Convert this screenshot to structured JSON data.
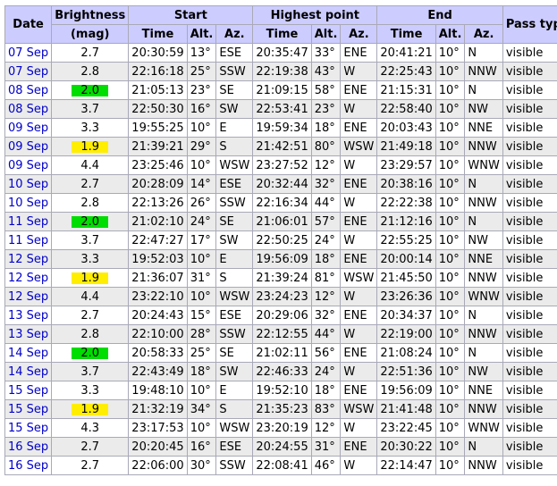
{
  "header": {
    "date": "Date",
    "brightness": "Brightness",
    "mag": "(mag)",
    "start": "Start",
    "highest": "Highest point",
    "end": "End",
    "pass_type": "Pass type",
    "time": "Time",
    "alt": "Alt.",
    "az": "Az."
  },
  "highlight_colors": {
    "green": "#00dd00",
    "yellow": "#ffee00"
  },
  "rows": [
    {
      "date": "07 Sep",
      "mag": "2.7",
      "hl": "",
      "s_time": "20:30:59",
      "s_alt": "13°",
      "s_az": "ESE",
      "h_time": "20:35:47",
      "h_alt": "33°",
      "h_az": "ENE",
      "e_time": "20:41:21",
      "e_alt": "10°",
      "e_az": "N",
      "type": "visible"
    },
    {
      "date": "07 Sep",
      "mag": "2.8",
      "hl": "",
      "s_time": "22:16:18",
      "s_alt": "25°",
      "s_az": "SSW",
      "h_time": "22:19:38",
      "h_alt": "43°",
      "h_az": "W",
      "e_time": "22:25:43",
      "e_alt": "10°",
      "e_az": "NNW",
      "type": "visible"
    },
    {
      "date": "08 Sep",
      "mag": "2.0",
      "hl": "green",
      "s_time": "21:05:13",
      "s_alt": "23°",
      "s_az": "SE",
      "h_time": "21:09:15",
      "h_alt": "58°",
      "h_az": "ENE",
      "e_time": "21:15:31",
      "e_alt": "10°",
      "e_az": "N",
      "type": "visible"
    },
    {
      "date": "08 Sep",
      "mag": "3.7",
      "hl": "",
      "s_time": "22:50:30",
      "s_alt": "16°",
      "s_az": "SW",
      "h_time": "22:53:41",
      "h_alt": "23°",
      "h_az": "W",
      "e_time": "22:58:40",
      "e_alt": "10°",
      "e_az": "NW",
      "type": "visible"
    },
    {
      "date": "09 Sep",
      "mag": "3.3",
      "hl": "",
      "s_time": "19:55:25",
      "s_alt": "10°",
      "s_az": "E",
      "h_time": "19:59:34",
      "h_alt": "18°",
      "h_az": "ENE",
      "e_time": "20:03:43",
      "e_alt": "10°",
      "e_az": "NNE",
      "type": "visible"
    },
    {
      "date": "09 Sep",
      "mag": "1.9",
      "hl": "yellow",
      "s_time": "21:39:21",
      "s_alt": "29°",
      "s_az": "S",
      "h_time": "21:42:51",
      "h_alt": "80°",
      "h_az": "WSW",
      "e_time": "21:49:18",
      "e_alt": "10°",
      "e_az": "NNW",
      "type": "visible"
    },
    {
      "date": "09 Sep",
      "mag": "4.4",
      "hl": "",
      "s_time": "23:25:46",
      "s_alt": "10°",
      "s_az": "WSW",
      "h_time": "23:27:52",
      "h_alt": "12°",
      "h_az": "W",
      "e_time": "23:29:57",
      "e_alt": "10°",
      "e_az": "WNW",
      "type": "visible"
    },
    {
      "date": "10 Sep",
      "mag": "2.7",
      "hl": "",
      "s_time": "20:28:09",
      "s_alt": "14°",
      "s_az": "ESE",
      "h_time": "20:32:44",
      "h_alt": "32°",
      "h_az": "ENE",
      "e_time": "20:38:16",
      "e_alt": "10°",
      "e_az": "N",
      "type": "visible"
    },
    {
      "date": "10 Sep",
      "mag": "2.8",
      "hl": "",
      "s_time": "22:13:26",
      "s_alt": "26°",
      "s_az": "SSW",
      "h_time": "22:16:34",
      "h_alt": "44°",
      "h_az": "W",
      "e_time": "22:22:38",
      "e_alt": "10°",
      "e_az": "NNW",
      "type": "visible"
    },
    {
      "date": "11 Sep",
      "mag": "2.0",
      "hl": "green",
      "s_time": "21:02:10",
      "s_alt": "24°",
      "s_az": "SE",
      "h_time": "21:06:01",
      "h_alt": "57°",
      "h_az": "ENE",
      "e_time": "21:12:16",
      "e_alt": "10°",
      "e_az": "N",
      "type": "visible"
    },
    {
      "date": "11 Sep",
      "mag": "3.7",
      "hl": "",
      "s_time": "22:47:27",
      "s_alt": "17°",
      "s_az": "SW",
      "h_time": "22:50:25",
      "h_alt": "24°",
      "h_az": "W",
      "e_time": "22:55:25",
      "e_alt": "10°",
      "e_az": "NW",
      "type": "visible"
    },
    {
      "date": "12 Sep",
      "mag": "3.3",
      "hl": "",
      "s_time": "19:52:03",
      "s_alt": "10°",
      "s_az": "E",
      "h_time": "19:56:09",
      "h_alt": "18°",
      "h_az": "ENE",
      "e_time": "20:00:14",
      "e_alt": "10°",
      "e_az": "NNE",
      "type": "visible"
    },
    {
      "date": "12 Sep",
      "mag": "1.9",
      "hl": "yellow",
      "s_time": "21:36:07",
      "s_alt": "31°",
      "s_az": "S",
      "h_time": "21:39:24",
      "h_alt": "81°",
      "h_az": "WSW",
      "e_time": "21:45:50",
      "e_alt": "10°",
      "e_az": "NNW",
      "type": "visible"
    },
    {
      "date": "12 Sep",
      "mag": "4.4",
      "hl": "",
      "s_time": "23:22:10",
      "s_alt": "10°",
      "s_az": "WSW",
      "h_time": "23:24:23",
      "h_alt": "12°",
      "h_az": "W",
      "e_time": "23:26:36",
      "e_alt": "10°",
      "e_az": "WNW",
      "type": "visible"
    },
    {
      "date": "13 Sep",
      "mag": "2.7",
      "hl": "",
      "s_time": "20:24:43",
      "s_alt": "15°",
      "s_az": "ESE",
      "h_time": "20:29:06",
      "h_alt": "32°",
      "h_az": "ENE",
      "e_time": "20:34:37",
      "e_alt": "10°",
      "e_az": "N",
      "type": "visible"
    },
    {
      "date": "13 Sep",
      "mag": "2.8",
      "hl": "",
      "s_time": "22:10:00",
      "s_alt": "28°",
      "s_az": "SSW",
      "h_time": "22:12:55",
      "h_alt": "44°",
      "h_az": "W",
      "e_time": "22:19:00",
      "e_alt": "10°",
      "e_az": "NNW",
      "type": "visible"
    },
    {
      "date": "14 Sep",
      "mag": "2.0",
      "hl": "green",
      "s_time": "20:58:33",
      "s_alt": "25°",
      "s_az": "SE",
      "h_time": "21:02:11",
      "h_alt": "56°",
      "h_az": "ENE",
      "e_time": "21:08:24",
      "e_alt": "10°",
      "e_az": "N",
      "type": "visible"
    },
    {
      "date": "14 Sep",
      "mag": "3.7",
      "hl": "",
      "s_time": "22:43:49",
      "s_alt": "18°",
      "s_az": "SW",
      "h_time": "22:46:33",
      "h_alt": "24°",
      "h_az": "W",
      "e_time": "22:51:36",
      "e_alt": "10°",
      "e_az": "NW",
      "type": "visible"
    },
    {
      "date": "15 Sep",
      "mag": "3.3",
      "hl": "",
      "s_time": "19:48:10",
      "s_alt": "10°",
      "s_az": "E",
      "h_time": "19:52:10",
      "h_alt": "18°",
      "h_az": "ENE",
      "e_time": "19:56:09",
      "e_alt": "10°",
      "e_az": "NNE",
      "type": "visible"
    },
    {
      "date": "15 Sep",
      "mag": "1.9",
      "hl": "yellow",
      "s_time": "21:32:19",
      "s_alt": "34°",
      "s_az": "S",
      "h_time": "21:35:23",
      "h_alt": "83°",
      "h_az": "WSW",
      "e_time": "21:41:48",
      "e_alt": "10°",
      "e_az": "NNW",
      "type": "visible"
    },
    {
      "date": "15 Sep",
      "mag": "4.3",
      "hl": "",
      "s_time": "23:17:53",
      "s_alt": "10°",
      "s_az": "WSW",
      "h_time": "23:20:19",
      "h_alt": "12°",
      "h_az": "W",
      "e_time": "23:22:45",
      "e_alt": "10°",
      "e_az": "WNW",
      "type": "visible"
    },
    {
      "date": "16 Sep",
      "mag": "2.7",
      "hl": "",
      "s_time": "20:20:45",
      "s_alt": "16°",
      "s_az": "ESE",
      "h_time": "20:24:55",
      "h_alt": "31°",
      "h_az": "ENE",
      "e_time": "20:30:22",
      "e_alt": "10°",
      "e_az": "N",
      "type": "visible"
    },
    {
      "date": "16 Sep",
      "mag": "2.7",
      "hl": "",
      "s_time": "22:06:00",
      "s_alt": "30°",
      "s_az": "SSW",
      "h_time": "22:08:41",
      "h_alt": "46°",
      "h_az": "W",
      "e_time": "22:14:47",
      "e_alt": "10°",
      "e_az": "NNW",
      "type": "visible"
    }
  ]
}
